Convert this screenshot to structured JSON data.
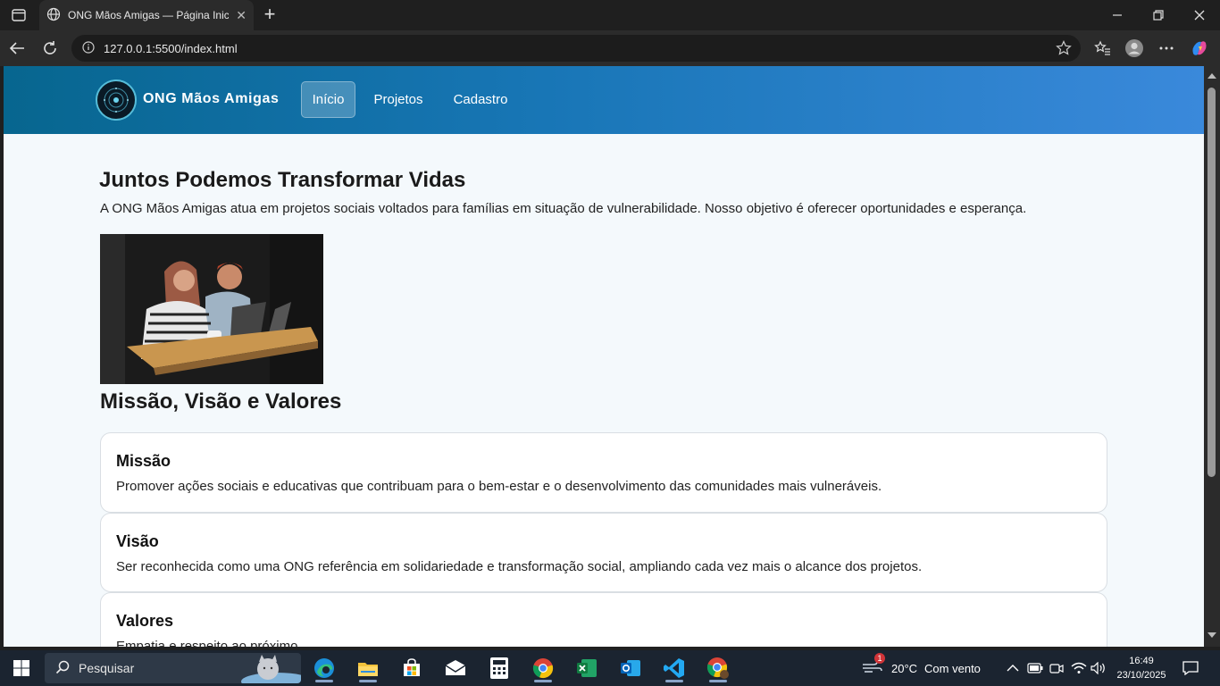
{
  "browser": {
    "tab_title": "ONG Mãos Amigas — Página Inicial",
    "url": "127.0.0.1:5500/index.html"
  },
  "site": {
    "brand": "ONG Mãos Amigas",
    "nav": [
      {
        "label": "Início",
        "active": true
      },
      {
        "label": "Projetos",
        "active": false
      },
      {
        "label": "Cadastro",
        "active": false
      }
    ],
    "hero_title": "Juntos Podemos Transformar Vidas",
    "hero_text": "A ONG Mãos Amigas atua em projetos sociais voltados para famílias em situação de vulnerabilidade. Nosso objetivo é oferecer oportunidades e esperança.",
    "section_title": "Missão, Visão e Valores",
    "cards": [
      {
        "title": "Missão",
        "text": "Promover ações sociais e educativas que contribuam para o bem-estar e o desenvolvimento das comunidades mais vulneráveis."
      },
      {
        "title": "Visão",
        "text": "Ser reconhecida como uma ONG referência em solidariedade e transformação social, ampliando cada vez mais o alcance dos projetos."
      },
      {
        "title": "Valores",
        "text": "Empatia e respeito ao próximo."
      }
    ]
  },
  "taskbar": {
    "search_placeholder": "Pesquisar",
    "weather_temp": "20°C",
    "weather_text": "Com vento",
    "weather_badge": "1",
    "time": "16:49",
    "date": "23/10/2025"
  },
  "colors": {
    "header_start": "#07668f",
    "header_end": "#3a89db",
    "page_bg": "#f4f9fc"
  }
}
